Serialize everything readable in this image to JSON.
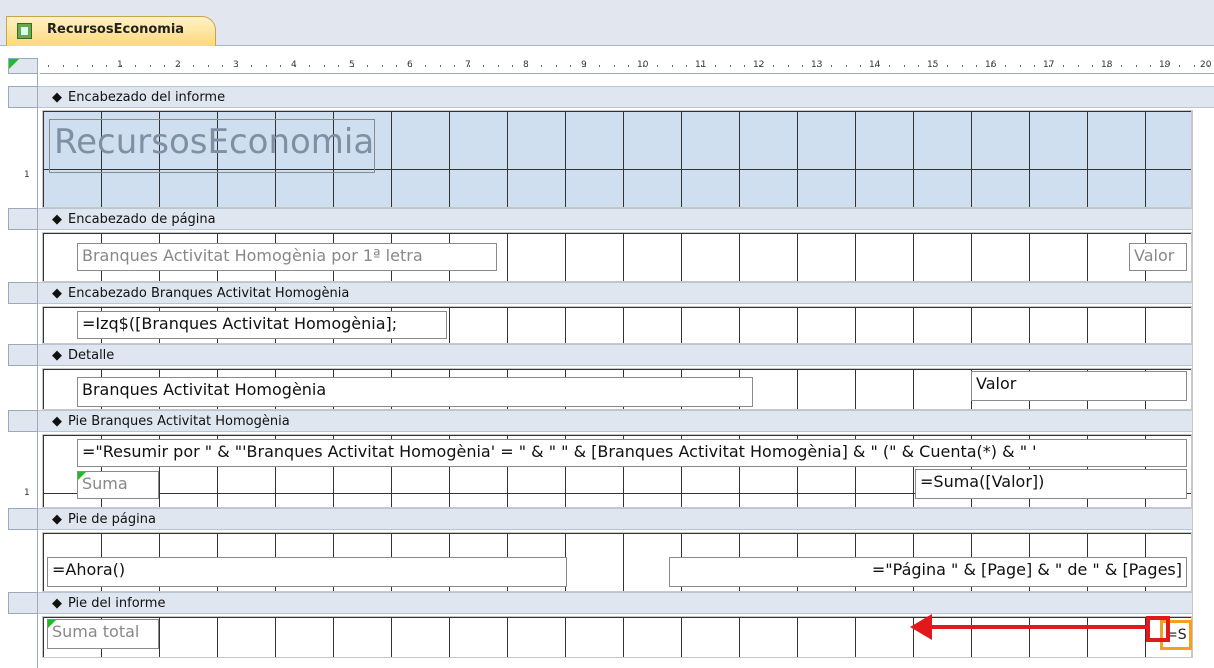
{
  "tab": {
    "title": "RecursosEconomia",
    "icon": "report-design-icon"
  },
  "ruler": {
    "numbers": [
      "1",
      "2",
      "3",
      "4",
      "5",
      "6",
      "7",
      "8",
      "9",
      "10",
      "11",
      "12",
      "13",
      "14",
      "15",
      "16",
      "17",
      "18",
      "19",
      "20"
    ]
  },
  "bands": {
    "report_header": {
      "title": "Encabezado del informe",
      "controls": {
        "title_label": "RecursosEconomia"
      }
    },
    "page_header": {
      "title": "Encabezado de página",
      "controls": {
        "branch_label": "Branques Activitat Homogènia por 1ª letra",
        "value_label": "Valor"
      }
    },
    "group_header": {
      "title": "Encabezado Branques Activitat Homogènia",
      "controls": {
        "izq_expr": "=Izq$([Branques Activitat Homogènia];"
      }
    },
    "detail": {
      "title": "Detalle",
      "controls": {
        "branch_field": "Branques Activitat Homogènia",
        "value_field": "Valor"
      }
    },
    "group_footer": {
      "title": "Pie Branques Activitat Homogènia",
      "controls": {
        "summary_expr": "=\"Resumir por \" & \"'Branques Activitat Homogènia' = \" & \" \" & [Branques Activitat Homogènia] & \" (\" & Cuenta(*) & \" '",
        "sum_label": "Suma",
        "sum_expr": "=Suma([Valor])"
      }
    },
    "page_footer": {
      "title": "Pie de página",
      "controls": {
        "now_expr": "=Ahora()",
        "page_expr": "=\"Página \" & [Page] & \" de \" & [Pages]"
      }
    },
    "report_footer": {
      "title": "Pie del informe",
      "controls": {
        "total_label": "Suma total",
        "total_expr": "=S"
      }
    }
  },
  "vruler_marks": {
    "r1": "1",
    "r2": "1"
  },
  "colors": {
    "annotation_arrow": "#e01a1a",
    "selection_handle": "#f2a020",
    "report_header_bg": "#d0dff0"
  }
}
